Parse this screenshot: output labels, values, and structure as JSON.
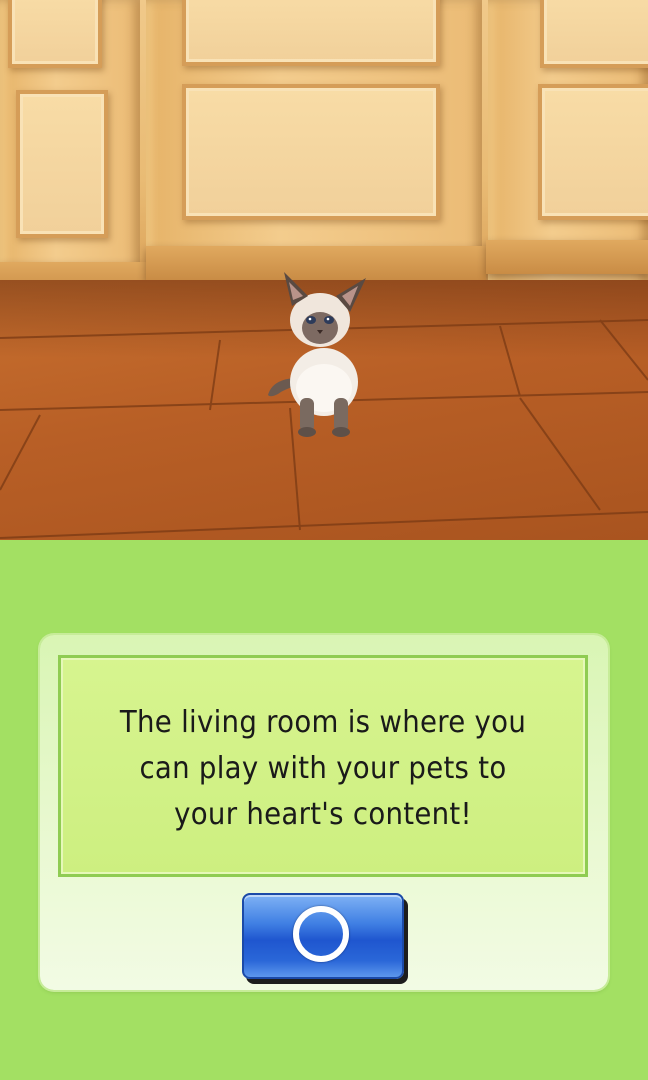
{
  "scene": {
    "location": "living room",
    "pet": "siamese-kitten"
  },
  "dialog": {
    "message": "The living room is where you can play with your pets to your heart's content!",
    "confirm_icon": "circle-icon"
  },
  "colors": {
    "bottom_screen_bg": "#a3e063",
    "message_box_bg": "#cdef80",
    "message_box_border": "#8fcc52",
    "button_blue": "#2a67d8",
    "floor": "#b85f26",
    "wall": "#f0c98a"
  }
}
